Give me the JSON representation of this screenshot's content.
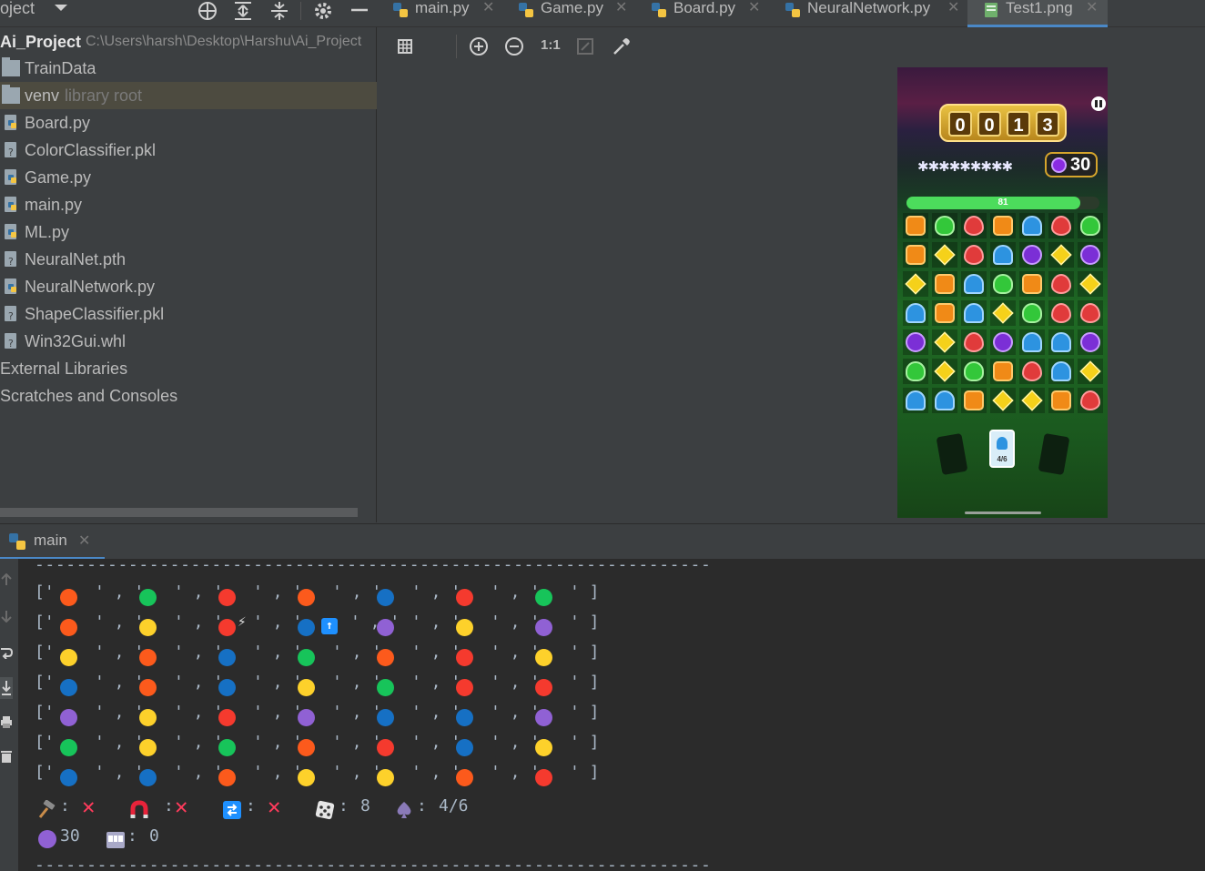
{
  "top": {
    "project_dropdown": "oject",
    "tabs": [
      {
        "label": "main.py",
        "icon": "python-file-icon"
      },
      {
        "label": "Game.py",
        "icon": "python-file-icon"
      },
      {
        "label": "Board.py",
        "icon": "python-file-icon"
      },
      {
        "label": "NeuralNetwork.py",
        "icon": "python-file-icon"
      },
      {
        "label": "Test1.png",
        "icon": "image-file-icon",
        "active": true
      }
    ]
  },
  "project": {
    "root_name": "Ai_Project",
    "root_path": "C:\\Users\\harsh\\Desktop\\Harshu\\Ai_Project",
    "items": [
      {
        "label": "TrainData",
        "icon": "folder-icon"
      },
      {
        "label": "venv",
        "sublabel": "library root",
        "icon": "folder-icon",
        "selected": true
      },
      {
        "label": "Board.py",
        "icon": "python-file-icon"
      },
      {
        "label": "ColorClassifier.pkl",
        "icon": "unknown-file-icon"
      },
      {
        "label": "Game.py",
        "icon": "python-file-icon"
      },
      {
        "label": "main.py",
        "icon": "python-file-icon"
      },
      {
        "label": "ML.py",
        "icon": "python-file-icon"
      },
      {
        "label": "NeuralNet.pth",
        "icon": "unknown-file-icon"
      },
      {
        "label": "NeuralNetwork.py",
        "icon": "python-file-icon"
      },
      {
        "label": "ShapeClassifier.pkl",
        "icon": "unknown-file-icon"
      },
      {
        "label": "Win32Gui.whl",
        "icon": "unknown-file-icon"
      },
      {
        "label": "External Libraries"
      },
      {
        "label": "Scratches and Consoles"
      }
    ]
  },
  "image_toolbar": {
    "actual_size_label": "1:1"
  },
  "game": {
    "score_digits": [
      "0",
      "0",
      "1",
      "3"
    ],
    "stars": "✱✱✱✱✱✱✱✱✱",
    "gem_count": "30",
    "progress_value": "81",
    "progress_fraction": 0.9,
    "card_label": "4/6",
    "board": [
      [
        "orange",
        "green",
        "red",
        "orange",
        "blue",
        "red",
        "green"
      ],
      [
        "orange",
        "yellow",
        "red",
        "blue",
        "purple",
        "yellow",
        "purple"
      ],
      [
        "yellow",
        "orange",
        "blue",
        "green",
        "orange",
        "red",
        "yellow"
      ],
      [
        "blue",
        "orange",
        "blue",
        "yellow",
        "green",
        "red",
        "red"
      ],
      [
        "purple",
        "yellow",
        "red",
        "purple",
        "blue",
        "blue",
        "purple"
      ],
      [
        "green",
        "yellow",
        "green",
        "orange",
        "red",
        "blue",
        "yellow"
      ],
      [
        "blue",
        "blue",
        "orange",
        "yellow",
        "yellow",
        "orange",
        "red"
      ]
    ]
  },
  "run": {
    "tab_label": "main",
    "dash_line": "-----------------------------------------------------------------",
    "console_rows": [
      [
        {
          "c": "#fc5a1c"
        },
        {
          "c": "#17c45a"
        },
        {
          "c": "#f53a2e"
        },
        {
          "c": "#fc5a1c"
        },
        {
          "c": "#1670c4"
        },
        {
          "c": "#f53a2e"
        },
        {
          "c": "#17c45a"
        }
      ],
      [
        {
          "c": "#fc5a1c"
        },
        {
          "c": "#fdd12b"
        },
        {
          "c": "#f53a2e",
          "extra": "bolt"
        },
        {
          "c": "#1670c4",
          "extra": "up"
        },
        {
          "c": "#9061d4"
        },
        {
          "c": "#fdd12b"
        },
        {
          "c": "#9061d4"
        }
      ],
      [
        {
          "c": "#fdd12b"
        },
        {
          "c": "#fc5a1c"
        },
        {
          "c": "#1670c4"
        },
        {
          "c": "#17c45a"
        },
        {
          "c": "#fc5a1c"
        },
        {
          "c": "#f53a2e"
        },
        {
          "c": "#fdd12b"
        }
      ],
      [
        {
          "c": "#1670c4"
        },
        {
          "c": "#fc5a1c"
        },
        {
          "c": "#1670c4"
        },
        {
          "c": "#fdd12b"
        },
        {
          "c": "#17c45a"
        },
        {
          "c": "#f53a2e"
        },
        {
          "c": "#f53a2e"
        }
      ],
      [
        {
          "c": "#9061d4"
        },
        {
          "c": "#fdd12b"
        },
        {
          "c": "#f53a2e"
        },
        {
          "c": "#9061d4"
        },
        {
          "c": "#1670c4"
        },
        {
          "c": "#1670c4"
        },
        {
          "c": "#9061d4"
        }
      ],
      [
        {
          "c": "#17c45a"
        },
        {
          "c": "#fdd12b"
        },
        {
          "c": "#17c45a"
        },
        {
          "c": "#fc5a1c"
        },
        {
          "c": "#f53a2e"
        },
        {
          "c": "#1670c4"
        },
        {
          "c": "#fdd12b"
        }
      ],
      [
        {
          "c": "#1670c4"
        },
        {
          "c": "#1670c4"
        },
        {
          "c": "#fc5a1c"
        },
        {
          "c": "#fdd12b"
        },
        {
          "c": "#fdd12b"
        },
        {
          "c": "#fc5a1c"
        },
        {
          "c": "#f53a2e"
        }
      ]
    ],
    "stats": {
      "hammer_icon": "hammer-icon",
      "magnet_icon": "magnet-icon",
      "shuffle_icon": "shuffle-icon",
      "cross_glyph": "✕",
      "dice_icon": "dice-icon",
      "dice_value": "8",
      "spade_icon": "spade-icon",
      "spade_value": "4/6",
      "gem_value": "30",
      "slot_icon": "slot-machine-icon",
      "slot_value": "0",
      "colon": ":"
    }
  }
}
